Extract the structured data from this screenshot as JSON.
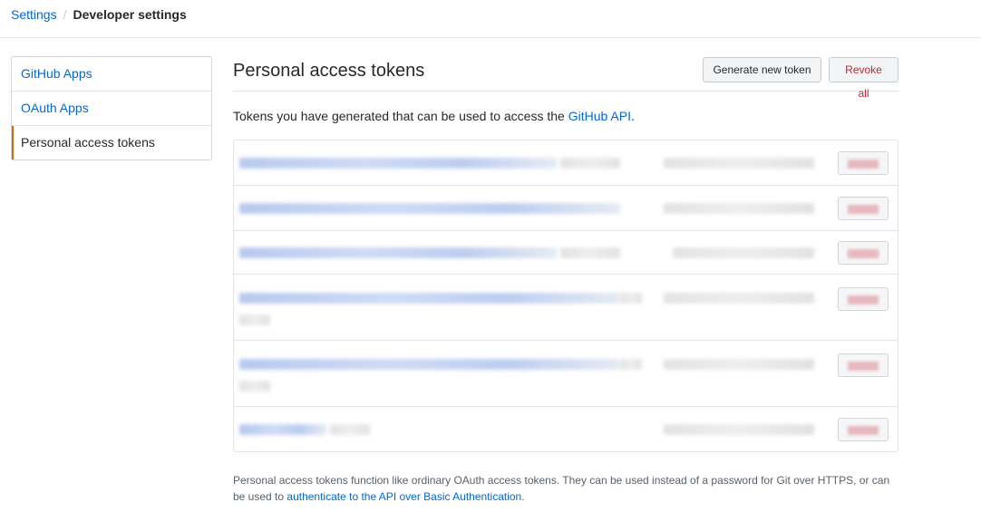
{
  "breadcrumb": {
    "root": "Settings",
    "separator": "/",
    "current": "Developer settings"
  },
  "sidebar": {
    "items": [
      {
        "label": "GitHub Apps",
        "active": false
      },
      {
        "label": "OAuth Apps",
        "active": false
      },
      {
        "label": "Personal access tokens",
        "active": true
      }
    ]
  },
  "main": {
    "title": "Personal access tokens",
    "generate_button": "Generate new token",
    "revoke_button": "Revoke all",
    "desc_prefix": "Tokens you have generated that can be used to access the ",
    "desc_link": "GitHub API",
    "desc_suffix": "."
  },
  "tokens": {
    "count": 6,
    "content": "redacted (blurred)"
  },
  "footer": {
    "text": "Personal access tokens function like ordinary OAuth access tokens. They can be used instead of a password for Git over HTTPS, or can be used to ",
    "link": "authenticate to the API over Basic Authentication",
    "suffix": "."
  },
  "colors": {
    "link": "#0366d6",
    "danger": "#cb2431",
    "active_marker": "#e36209",
    "border": "#e1e4e8"
  }
}
